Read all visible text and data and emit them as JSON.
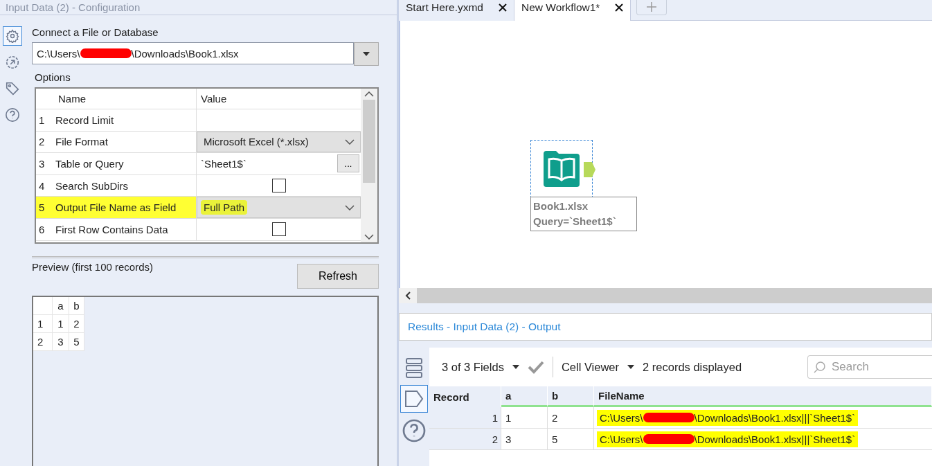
{
  "config": {
    "title": "Input Data (2) - Configuration",
    "connect_label": "Connect a File or Database",
    "file_path": {
      "before": "C:\\Users\\",
      "after": "\\Downloads\\Book1.xlsx",
      "redacted": true
    },
    "options": {
      "label": "Options",
      "columns": [
        "Name",
        "Value"
      ],
      "rows": [
        {
          "num": "1",
          "name": "Record Limit",
          "kind": "text",
          "value": "",
          "highlighted": false
        },
        {
          "num": "2",
          "name": "File Format",
          "kind": "select",
          "value": "Microsoft Excel (*.xlsx)",
          "highlighted": false
        },
        {
          "num": "3",
          "name": "Table or Query",
          "kind": "browse",
          "value": "`Sheet1$`",
          "button": "...",
          "highlighted": false
        },
        {
          "num": "4",
          "name": "Search SubDirs",
          "kind": "checkbox",
          "checked": false,
          "highlighted": false
        },
        {
          "num": "5",
          "name": "Output File Name as Field",
          "kind": "select",
          "value": "Full Path",
          "highlighted": true
        },
        {
          "num": "6",
          "name": "First Row Contains Data",
          "kind": "checkbox",
          "checked": false,
          "highlighted": false
        }
      ]
    },
    "preview": {
      "label": "Preview (first 100 records)",
      "refresh": "Refresh",
      "columns": [
        "a",
        "b"
      ],
      "rows": [
        {
          "num": "1",
          "cells": [
            "1",
            "2"
          ]
        },
        {
          "num": "2",
          "cells": [
            "3",
            "5"
          ]
        }
      ]
    }
  },
  "tabs": [
    {
      "label": "Start Here.yxmd",
      "selected": false
    },
    {
      "label": "New Workflow1*",
      "selected": true
    }
  ],
  "node": {
    "title": "Book1.xlsx",
    "query": "Query=`Sheet1$`",
    "selected": true
  },
  "results": {
    "title": "Results - Input Data (2) - Output",
    "fields": "3 of 3 Fields",
    "viewer": "Cell Viewer",
    "count": "2 records displayed",
    "search": {
      "placeholder": "Search"
    },
    "columns": [
      "Record",
      "a",
      "b",
      "FileName"
    ],
    "rows": [
      {
        "record": "1",
        "a": "1",
        "b": "2",
        "filename": {
          "before": "C:\\Users\\",
          "after": "\\Downloads\\Book1.xlsx|||`Sheet1$`",
          "redacted": true
        },
        "highlighted": true
      },
      {
        "record": "2",
        "a": "3",
        "b": "5",
        "filename": {
          "before": "C:\\Users\\",
          "after": "\\Downloads\\Book1.xlsx|||`Sheet1$`",
          "redacted": true
        },
        "highlighted": true
      }
    ]
  }
}
